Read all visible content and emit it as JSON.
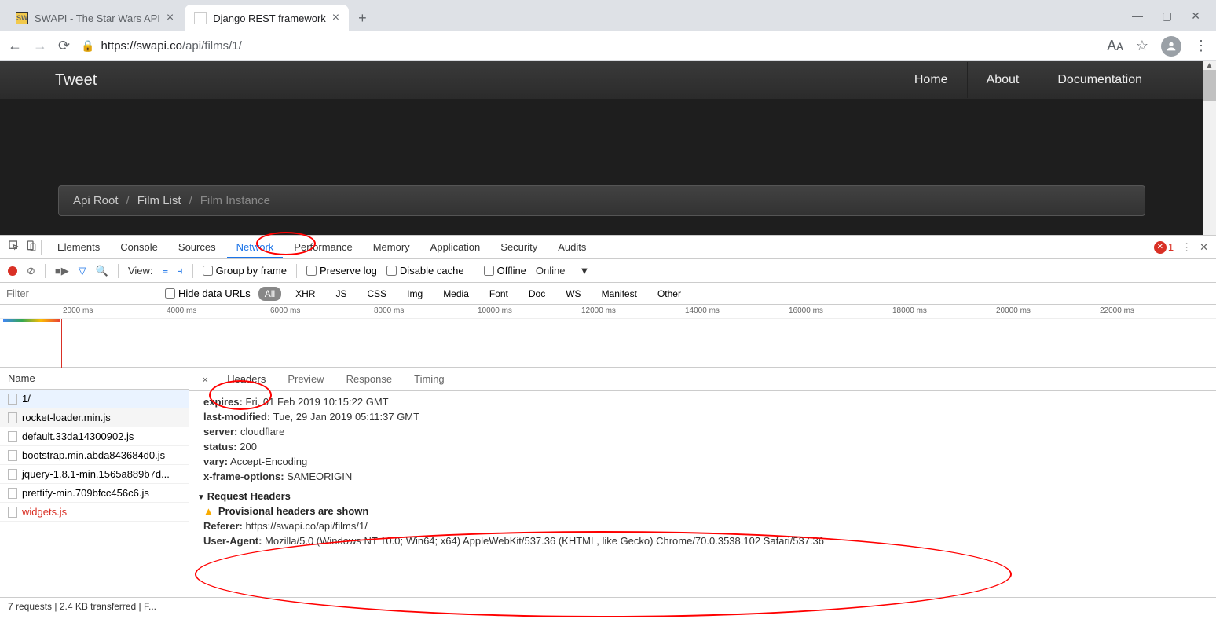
{
  "browser": {
    "tabs": [
      {
        "title": "SWAPI - The Star Wars API",
        "active": false
      },
      {
        "title": "Django REST framework",
        "active": true
      }
    ],
    "url_host": "https://swapi.co",
    "url_path": "/api/films/1/"
  },
  "page": {
    "brand": "Tweet",
    "nav": [
      "Home",
      "About",
      "Documentation"
    ],
    "breadcrumb": {
      "root": "Api Root",
      "list": "Film List",
      "current": "Film Instance"
    }
  },
  "devtools": {
    "tabs": [
      "Elements",
      "Console",
      "Sources",
      "Network",
      "Performance",
      "Memory",
      "Application",
      "Security",
      "Audits"
    ],
    "active_tab": "Network",
    "error_count": "1",
    "toolbar": {
      "view_label": "View:",
      "group_by_frame": "Group by frame",
      "preserve_log": "Preserve log",
      "disable_cache": "Disable cache",
      "offline": "Offline",
      "online": "Online"
    },
    "filter": {
      "placeholder": "Filter",
      "hide_urls": "Hide data URLs",
      "types": [
        "All",
        "XHR",
        "JS",
        "CSS",
        "Img",
        "Media",
        "Font",
        "Doc",
        "WS",
        "Manifest",
        "Other"
      ]
    },
    "timeline_ticks": [
      "2000 ms",
      "4000 ms",
      "6000 ms",
      "8000 ms",
      "10000 ms",
      "12000 ms",
      "14000 ms",
      "16000 ms",
      "18000 ms",
      "20000 ms",
      "22000 ms"
    ],
    "requests": {
      "header": "Name",
      "rows": [
        {
          "name": "1/",
          "selected": true
        },
        {
          "name": "rocket-loader.min.js",
          "hover": true
        },
        {
          "name": "default.33da14300902.js"
        },
        {
          "name": "bootstrap.min.abda843684d0.js"
        },
        {
          "name": "jquery-1.8.1-min.1565a889b7d..."
        },
        {
          "name": "prettify-min.709bfcc456c6.js"
        },
        {
          "name": "widgets.js",
          "error": true
        }
      ]
    },
    "detail": {
      "tabs": [
        "Headers",
        "Preview",
        "Response",
        "Timing"
      ],
      "active": "Headers",
      "response_headers": [
        {
          "key": "expires:",
          "val": "Fri, 01 Feb 2019 10:15:22 GMT"
        },
        {
          "key": "last-modified:",
          "val": "Tue, 29 Jan 2019 05:11:37 GMT"
        },
        {
          "key": "server:",
          "val": "cloudflare"
        },
        {
          "key": "status:",
          "val": "200"
        },
        {
          "key": "vary:",
          "val": "Accept-Encoding"
        },
        {
          "key": "x-frame-options:",
          "val": "SAMEORIGIN"
        }
      ],
      "request_section": "Request Headers",
      "provisional_warning": "Provisional headers are shown",
      "request_headers": [
        {
          "key": "Referer:",
          "val": "https://swapi.co/api/films/1/"
        },
        {
          "key": "User-Agent:",
          "val": "Mozilla/5.0 (Windows NT 10.0; Win64; x64) AppleWebKit/537.36 (KHTML, like Gecko) Chrome/70.0.3538.102 Safari/537.36"
        }
      ]
    },
    "status_bar": "7 requests  |  2.4 KB transferred  |  F..."
  }
}
